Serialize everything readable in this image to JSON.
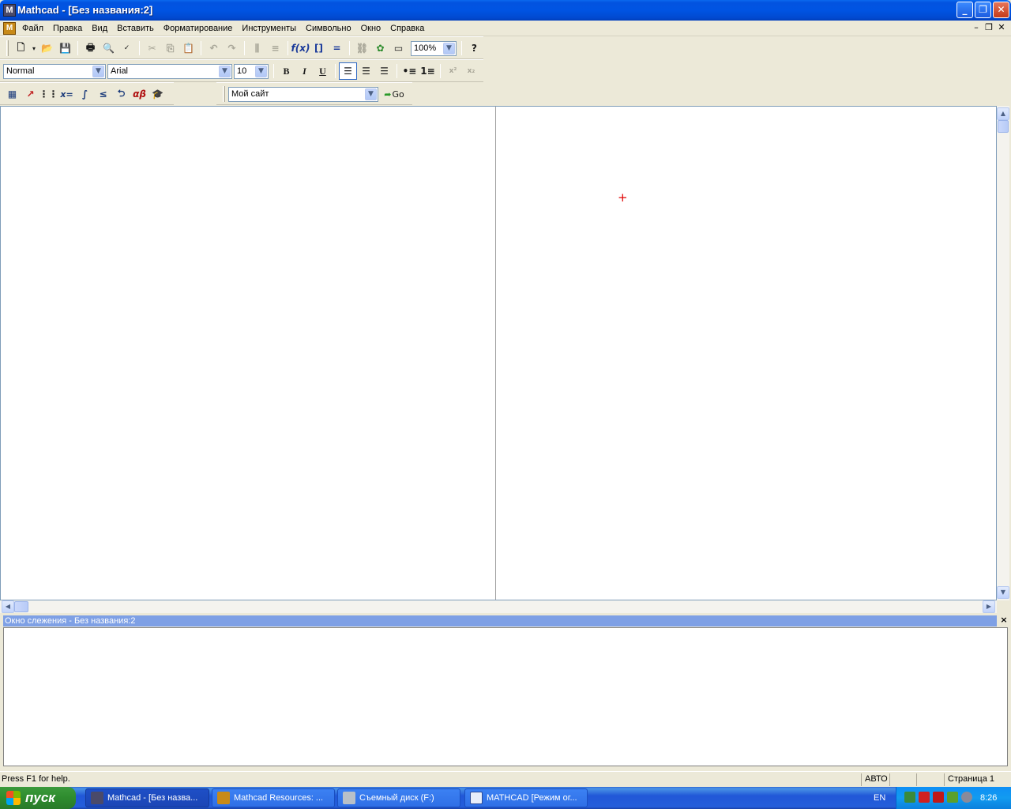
{
  "window": {
    "title": "Mathcad - [Без названия:2]",
    "app_icon": "M",
    "controls": {
      "minimize": "_",
      "restore": "❐",
      "close": "✕"
    }
  },
  "menubar": {
    "items": [
      "Файл",
      "Правка",
      "Вид",
      "Вставить",
      "Форматирование",
      "Инструменты",
      "Символьно",
      "Окно",
      "Справка"
    ]
  },
  "toolbar_standard": {
    "zoom": "100%",
    "icons": [
      "new-document-icon",
      "open-folder-icon",
      "save-icon",
      "print-icon",
      "print-preview-icon",
      "spell-check-icon",
      "cut-icon",
      "copy-icon",
      "paste-icon",
      "undo-icon",
      "redo-icon",
      "align-across-icon",
      "align-down-icon",
      "insert-function-icon",
      "insert-unit-icon",
      "calculate-icon",
      "insert-hyperlink-icon",
      "component-wizard-icon",
      "insert-region-icon",
      "help-icon"
    ]
  },
  "toolbar_formatting": {
    "style": "Normal",
    "font": "Arial",
    "size": "10",
    "bold": "B",
    "italic": "I",
    "underline": "U",
    "superscript": "x²",
    "subscript": "x₂"
  },
  "toolbar_math": {
    "evaluation_label": "x=",
    "greek_label": "αβ",
    "resource_site": "Мой сайт",
    "go_label": "Go"
  },
  "document": {
    "cursor": "+"
  },
  "trace_window": {
    "title": "Окно слежения - Без названия:2",
    "close": "×"
  },
  "statusbar": {
    "help": "Press F1 for help.",
    "mode": "АВТО",
    "page": "Страница 1"
  },
  "taskbar": {
    "start_label": "пуск",
    "tasks": [
      {
        "label": "Mathcad - [Без назва...",
        "active": true
      },
      {
        "label": "Mathcad Resources: ...",
        "active": false
      },
      {
        "label": "Съемный диск (F:)",
        "active": false
      },
      {
        "label": "MATHCAD [Режим ог...",
        "active": false
      }
    ],
    "language": "EN",
    "clock": "8:26"
  },
  "colors": {
    "titlebar": "#0054e3",
    "trace_title": "#7ea0e5",
    "cursor": "#e00000",
    "start_button": "#2e8b2e"
  }
}
